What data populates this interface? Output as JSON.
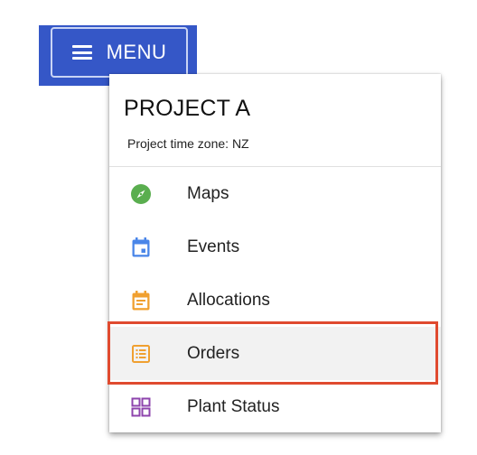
{
  "menu_button": {
    "label": "MENU",
    "icon": "hamburger-icon",
    "background": "#3557c7"
  },
  "panel": {
    "project_title": "PROJECT A",
    "time_zone_text": "Project time zone: NZ"
  },
  "items": [
    {
      "label": "Maps",
      "icon": "compass-icon",
      "color": "#5aae4f"
    },
    {
      "label": "Events",
      "icon": "calendar-icon",
      "color": "#4a86e8"
    },
    {
      "label": "Allocations",
      "icon": "calendar-list-icon",
      "color": "#f0a030"
    },
    {
      "label": "Orders",
      "icon": "list-icon",
      "color": "#f0a030",
      "selected": true
    },
    {
      "label": "Plant Status",
      "icon": "grid-icon",
      "color": "#8e44ad"
    }
  ],
  "highlight_color": "#e04a2f"
}
